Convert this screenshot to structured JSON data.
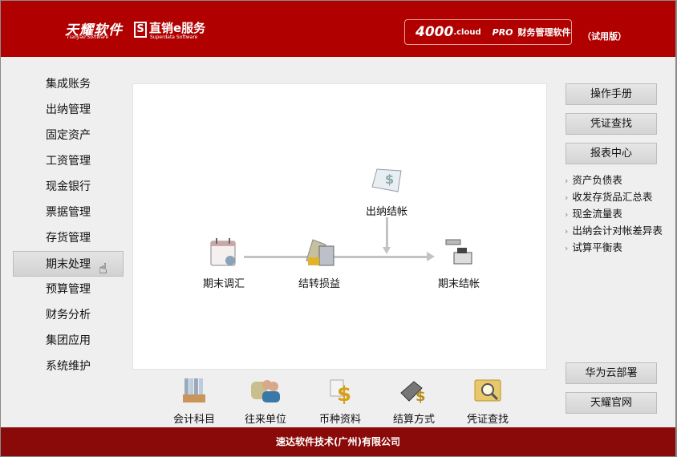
{
  "header": {
    "logo_cn": "天耀软件",
    "logo_en": "Tianyao Software",
    "logo2_cn": "直销e服务",
    "logo2_en": "Superdata Software",
    "product_num": "4000",
    "product_cloud": ".cloud",
    "product_pro": "PRO",
    "product_name": "财务管理软件",
    "trial": "（试用版）"
  },
  "sidebar": {
    "items": [
      "集成账务",
      "出纳管理",
      "固定资产",
      "工资管理",
      "现金银行",
      "票据管理",
      "存货管理",
      "期末处理",
      "预算管理",
      "财务分析",
      "集团应用",
      "系统维护"
    ],
    "active": "期末处理"
  },
  "flow": {
    "nodes": [
      "期末调汇",
      "结转损益",
      "出纳结帐",
      "期末结帐"
    ]
  },
  "right": {
    "buttons": [
      "操作手册",
      "凭证查找",
      "报表中心"
    ],
    "reports": [
      "资产负债表",
      "收发存货品汇总表",
      "现金流量表",
      "出纳会计对帐差异表",
      "试算平衡表"
    ],
    "bottom_buttons": [
      "华为云部署",
      "天耀官网"
    ]
  },
  "toolbar": {
    "items": [
      "会计科目",
      "往来单位",
      "币种资料",
      "结算方式",
      "凭证查找"
    ]
  },
  "footer": {
    "company": "速达软件技术(广州)有限公司"
  }
}
